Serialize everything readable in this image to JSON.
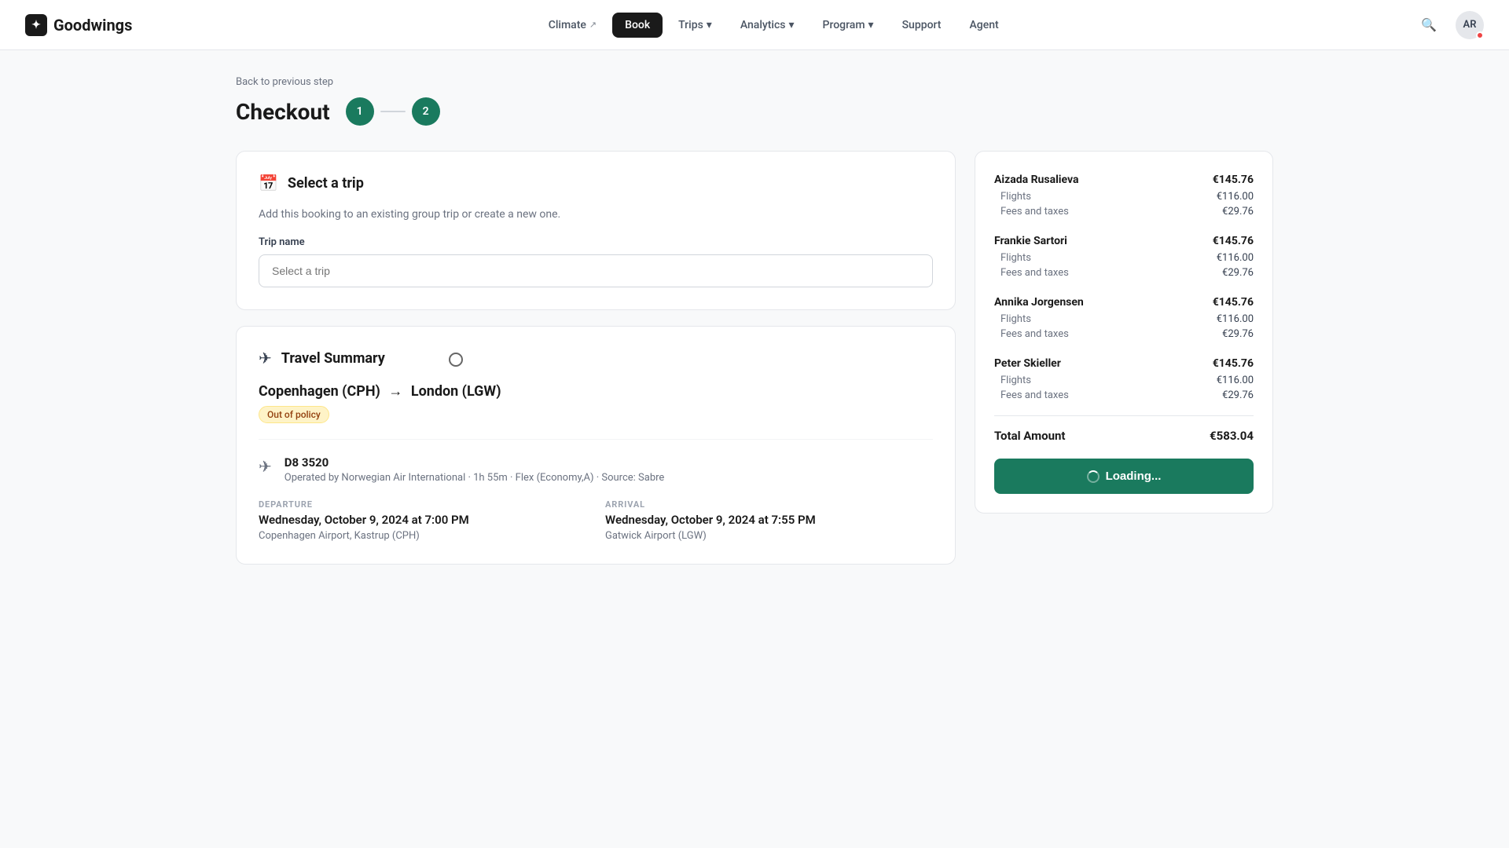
{
  "brand": {
    "logo_text": "Goodwings",
    "logo_icon": "✦"
  },
  "nav": {
    "items": [
      {
        "id": "climate",
        "label": "Climate",
        "active": false,
        "external": true
      },
      {
        "id": "book",
        "label": "Book",
        "active": true,
        "external": false
      },
      {
        "id": "trips",
        "label": "Trips",
        "active": false,
        "external": false,
        "dropdown": true
      },
      {
        "id": "analytics",
        "label": "Analytics",
        "active": false,
        "external": false,
        "dropdown": true
      },
      {
        "id": "program",
        "label": "Program",
        "active": false,
        "external": false,
        "dropdown": true
      },
      {
        "id": "support",
        "label": "Support",
        "active": false,
        "external": false
      },
      {
        "id": "agent",
        "label": "Agent",
        "active": false,
        "external": false
      }
    ],
    "avatar_initials": "AR",
    "avatar_has_dot": true
  },
  "page": {
    "back_label": "Back to previous step",
    "title": "Checkout",
    "step1": "1",
    "step2": "2"
  },
  "select_trip": {
    "section_title": "Select a trip",
    "description": "Add this booking to an existing group trip or create a new one.",
    "trip_name_label": "Trip name",
    "trip_input_placeholder": "Select a trip"
  },
  "travel_summary": {
    "section_title": "Travel Summary",
    "route": "Copenhagen (CPH) → London (LGW)",
    "route_from": "Copenhagen (CPH)",
    "route_to": "London (LGW)",
    "out_of_policy_label": "Out of policy",
    "flight_number": "D8 3520",
    "flight_meta": "Operated by Norwegian Air International · 1h 55m · Flex (Economy,A) · Source: Sabre",
    "departure_label": "DEPARTURE",
    "departure_time": "Wednesday, October 9, 2024 at 7:00 PM",
    "departure_airport": "Copenhagen Airport, Kastrup (CPH)",
    "arrival_label": "ARRIVAL",
    "arrival_time": "Wednesday, October 9, 2024 at 7:55 PM",
    "arrival_airport": "Gatwick Airport (LGW)"
  },
  "sidebar": {
    "passengers": [
      {
        "name": "Aizada Rusalieva",
        "total": "€145.76",
        "flights_label": "Flights",
        "flights_value": "€116.00",
        "taxes_label": "Fees and taxes",
        "taxes_value": "€29.76"
      },
      {
        "name": "Frankie Sartori",
        "total": "€145.76",
        "flights_label": "Flights",
        "flights_value": "€116.00",
        "taxes_label": "Fees and taxes",
        "taxes_value": "€29.76"
      },
      {
        "name": "Annika Jorgensen",
        "total": "€145.76",
        "flights_label": "Flights",
        "flights_value": "€116.00",
        "taxes_label": "Fees and taxes",
        "taxes_value": "€29.76"
      },
      {
        "name": "Peter Skieller",
        "total": "€145.76",
        "flights_label": "Flights",
        "flights_value": "€116.00",
        "taxes_label": "Fees and taxes",
        "taxes_value": "€29.76"
      }
    ],
    "total_label": "Total Amount",
    "total_value": "€583.04",
    "cta_label": "Loading..."
  }
}
